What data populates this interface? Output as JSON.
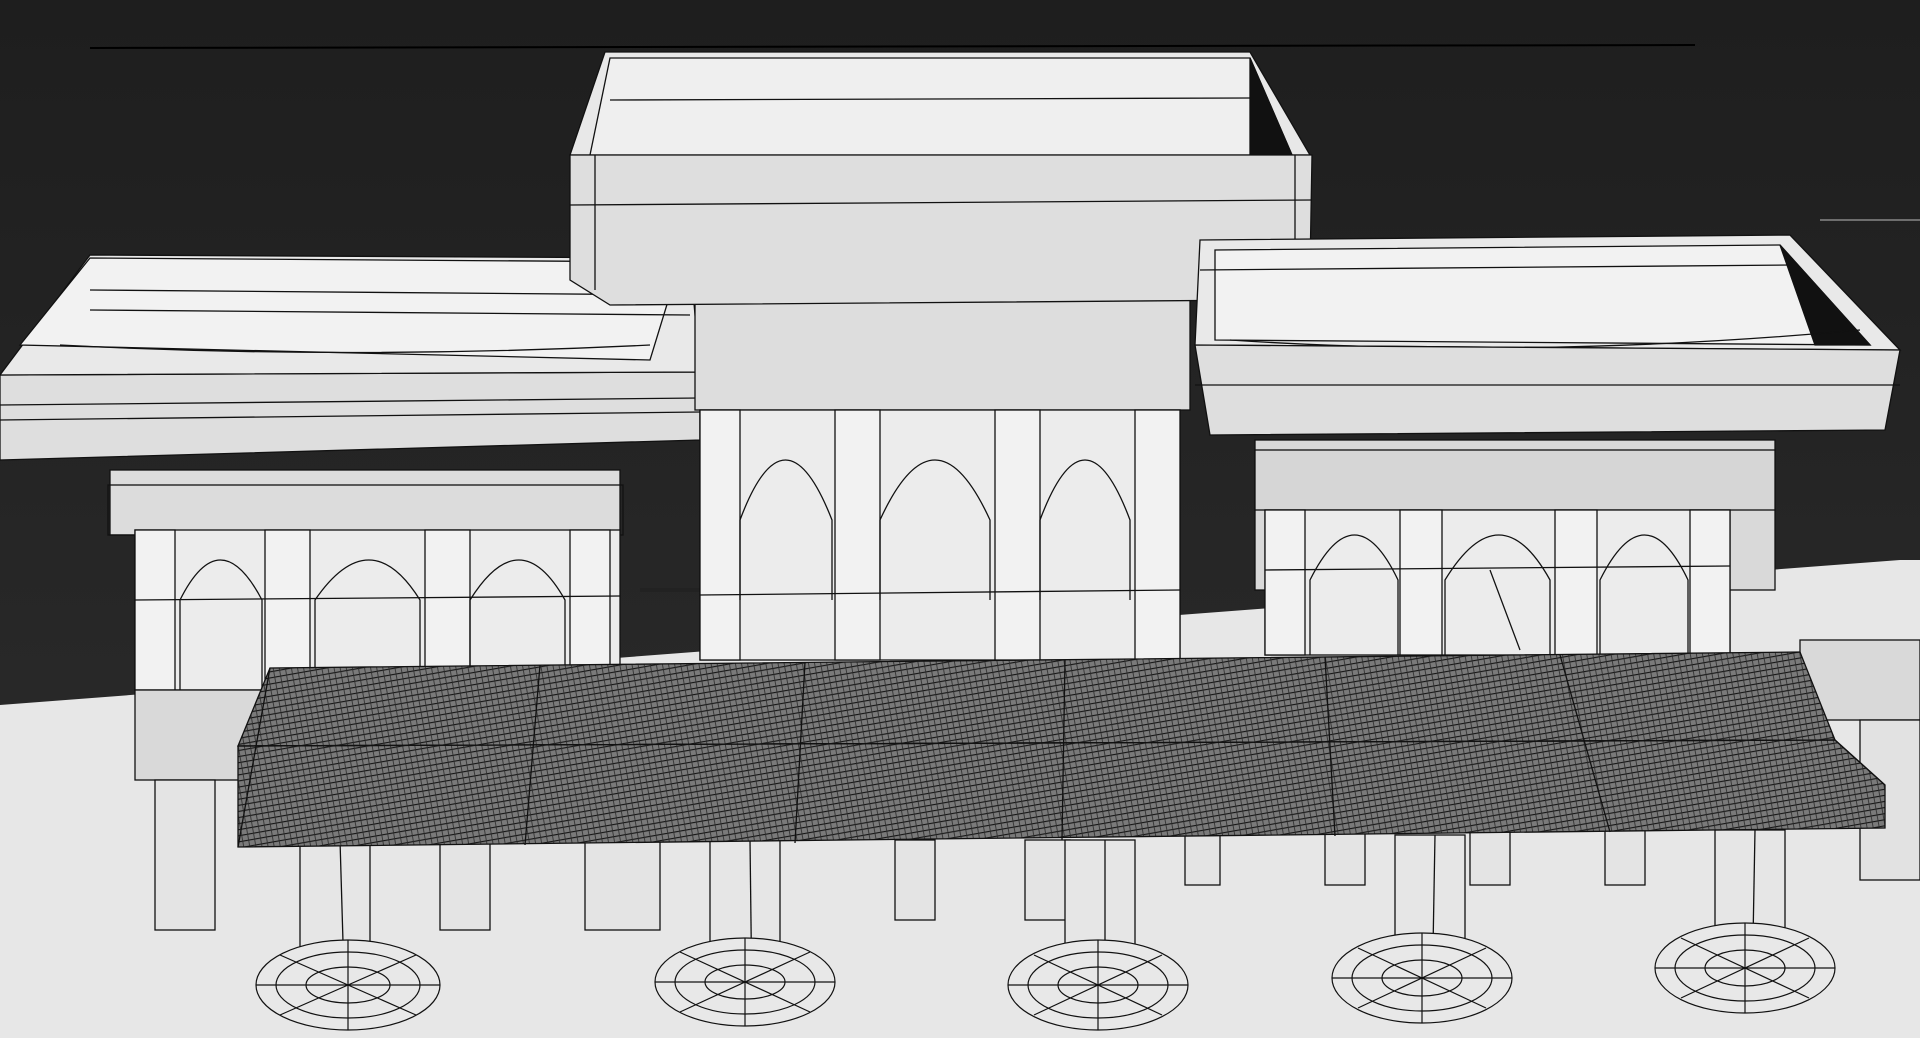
{
  "viewport": {
    "label": "",
    "background_top": "#1f1f1f",
    "background_bottom": "#2c2c2c",
    "ground_color": "#e6e6e6",
    "model_face_color": "#e2e2e2",
    "model_shadow_color": "#b8b8b8",
    "wire_color": "#111111",
    "accent_line_color": "#f5f5f5"
  },
  "scene_objects": [
    {
      "name": "left-tower-box"
    },
    {
      "name": "center-tower-box"
    },
    {
      "name": "right-tower-box"
    },
    {
      "name": "left-arcade"
    },
    {
      "name": "center-arcade"
    },
    {
      "name": "right-arcade"
    },
    {
      "name": "table-slab"
    },
    {
      "name": "table-legs"
    },
    {
      "name": "table-base-discs"
    }
  ]
}
